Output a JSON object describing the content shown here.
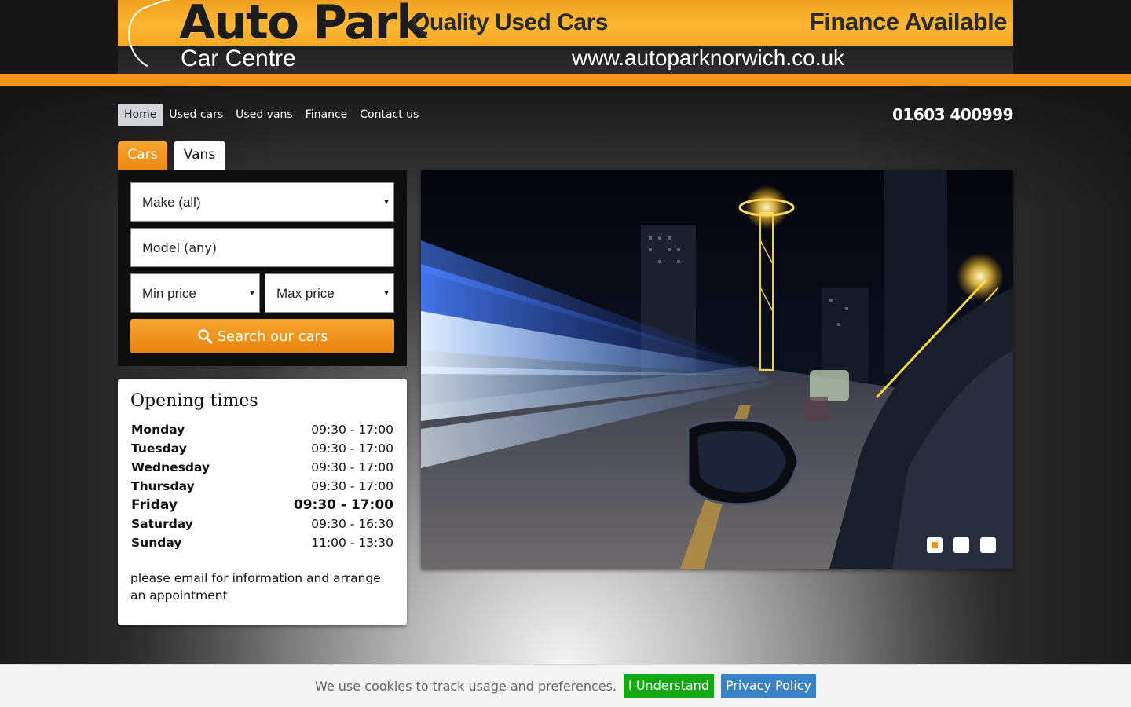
{
  "banner": {
    "logo_main": "Auto Park",
    "logo_sub": "Car Centre",
    "tagline_left": "Quality Used Cars",
    "tagline_right": "Finance Available",
    "website": "www.autoparknorwich.co.uk"
  },
  "nav": {
    "items": [
      {
        "label": "Home",
        "active": true
      },
      {
        "label": "Used cars"
      },
      {
        "label": "Used vans"
      },
      {
        "label": "Finance"
      },
      {
        "label": "Contact us"
      }
    ],
    "phone": "01603 400999"
  },
  "tabs": [
    {
      "label": "Cars",
      "active": true
    },
    {
      "label": "Vans"
    }
  ],
  "search": {
    "make": "Make (all)",
    "model_placeholder": "Model (any)",
    "min_price": "Min price",
    "max_price": "Max price",
    "button_label": "Search our cars"
  },
  "opening_times": {
    "title": "Opening times",
    "days": [
      {
        "day": "Monday",
        "hours": "09:30 - 17:00"
      },
      {
        "day": "Tuesday",
        "hours": "09:30 - 17:00"
      },
      {
        "day": "Wednesday",
        "hours": "09:30 - 17:00"
      },
      {
        "day": "Thursday",
        "hours": "09:30 - 17:00"
      },
      {
        "day": "Friday",
        "hours": "09:30 - 17:00",
        "today": true
      },
      {
        "day": "Saturday",
        "hours": "09:30 - 16:30"
      },
      {
        "day": "Sunday",
        "hours": "11:00 - 13:30"
      }
    ],
    "note": "please email for information and arrange an appointment"
  },
  "slideshow": {
    "slide_count": 3,
    "active_slide": 1
  },
  "cookie": {
    "message": "We use cookies to track usage and preferences.",
    "accept_label": "I Understand",
    "privacy_label": "Privacy Policy"
  },
  "colors": {
    "accent": "#f7941d",
    "accept_green": "#14a814",
    "privacy_blue": "#3b82c4"
  }
}
